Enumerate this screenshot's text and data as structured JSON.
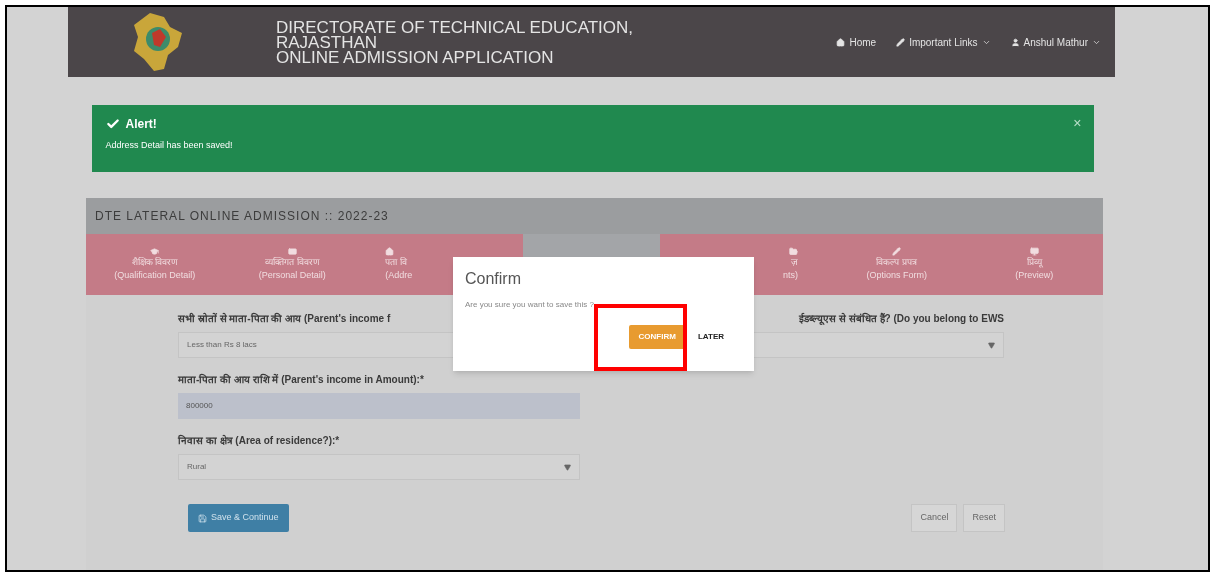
{
  "header": {
    "title_lines": [
      "DIRECTORATE OF TECHNICAL EDUCATION,",
      "RAJASTHAN",
      "ONLINE ADMISSION APPLICATION"
    ],
    "nav": [
      {
        "kind": "home",
        "label": "Home",
        "dropdown": false
      },
      {
        "kind": "link",
        "label": "Important Links",
        "dropdown": true
      },
      {
        "kind": "user",
        "label": "Anshul Mathur",
        "dropdown": true
      }
    ]
  },
  "alert": {
    "title": "Alert!",
    "message": "Address Detail has been saved!",
    "close": "×"
  },
  "panel": {
    "title": "DTE LATERAL ONLINE ADMISSION :: 2022-23"
  },
  "steps": [
    {
      "kind": "qualification",
      "label_hi": "शैक्षिक विवरण",
      "label_en": "(Qualification Detail)",
      "selected": false
    },
    {
      "kind": "personal",
      "label_hi": "व्यक्तिगत विवरण",
      "label_en": "(Personal Detail)",
      "selected": false
    },
    {
      "kind": "address",
      "label_hi": "पता वि",
      "label_en": "(Addre",
      "selected": false
    },
    {
      "kind": "other",
      "selected": true
    },
    {
      "kind": "documents",
      "label_hi": "ज़",
      "label_en": "nts)",
      "selected": false
    },
    {
      "kind": "options",
      "label_hi": "विकल्प प्रपत्र",
      "label_en": "(Options Form)",
      "selected": false
    },
    {
      "kind": "preview",
      "label_hi": "प्रिव्यू",
      "label_en": "(Preview)",
      "selected": false
    }
  ],
  "form": {
    "fields": [
      {
        "kind": "select",
        "label": "सभी स्रोतों से माता-पिता की आय (Parent's income f",
        "value": "Less than Rs 8 lacs"
      },
      {
        "kind": "select",
        "label": "ईडब्ल्यूएस से संबंधित हैं? (Do you belong to EWS"
      },
      {
        "kind": "input",
        "label": "माता-पिता की आय राशि में (Parent's income in Amount):*",
        "value": "800000"
      },
      {
        "kind": "blank"
      },
      {
        "kind": "select",
        "label": "निवास का क्षेत्र (Area of residence?):*",
        "value": "Rural"
      }
    ],
    "save": "Save & Continue",
    "cancel": "Cancel",
    "reset": "Reset"
  },
  "modal": {
    "title": "Confirm",
    "message": "Are you sure you want to save this ?",
    "confirm": "CONFIRM",
    "later": "LATER",
    "highlight_confirm": true
  }
}
